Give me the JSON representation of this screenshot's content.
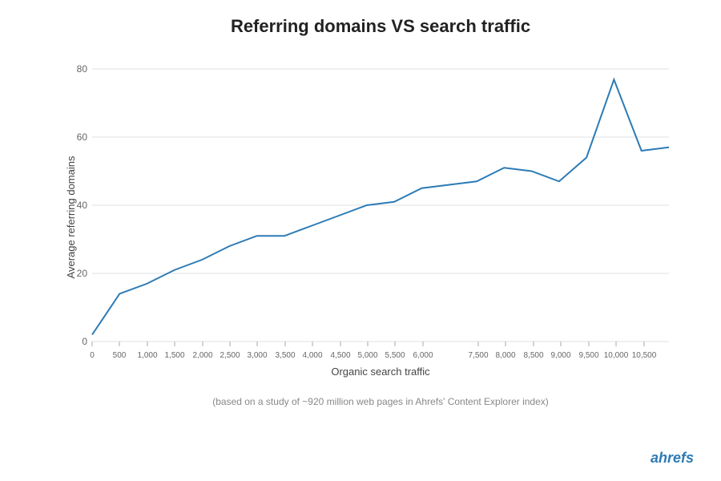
{
  "title": "Referring domains VS search traffic",
  "yAxisLabel": "Average referring domains",
  "xAxisLabel": "Organic search traffic",
  "footerNote": "(based on a study of ~920 million web pages in Ahrefs' Content Explorer index)",
  "brand": "ahrefs",
  "yTicks": [
    0,
    20,
    40,
    60,
    80
  ],
  "xTicks": [
    "0",
    "500",
    "1,000",
    "1,500",
    "2,000",
    "2,500",
    "3,000",
    "3,500",
    "4,000",
    "4,500",
    "5,000",
    "5,500",
    "6,000",
    "7,500",
    "8,000",
    "8,500",
    "9,000",
    "9,500",
    "10,000",
    "10,500"
  ],
  "chartLine": {
    "color": "#2c7bb6",
    "points": [
      [
        0,
        2
      ],
      [
        500,
        14
      ],
      [
        1000,
        17
      ],
      [
        1500,
        21
      ],
      [
        2000,
        24
      ],
      [
        2500,
        28
      ],
      [
        3000,
        31
      ],
      [
        3500,
        31
      ],
      [
        4000,
        34
      ],
      [
        4500,
        37
      ],
      [
        5000,
        40
      ],
      [
        5500,
        41
      ],
      [
        6000,
        45
      ],
      [
        6500,
        46
      ],
      [
        7000,
        47
      ],
      [
        7500,
        51
      ],
      [
        8000,
        50
      ],
      [
        8500,
        47
      ],
      [
        9000,
        54
      ],
      [
        9500,
        77
      ],
      [
        10000,
        56
      ],
      [
        10500,
        57
      ]
    ]
  }
}
